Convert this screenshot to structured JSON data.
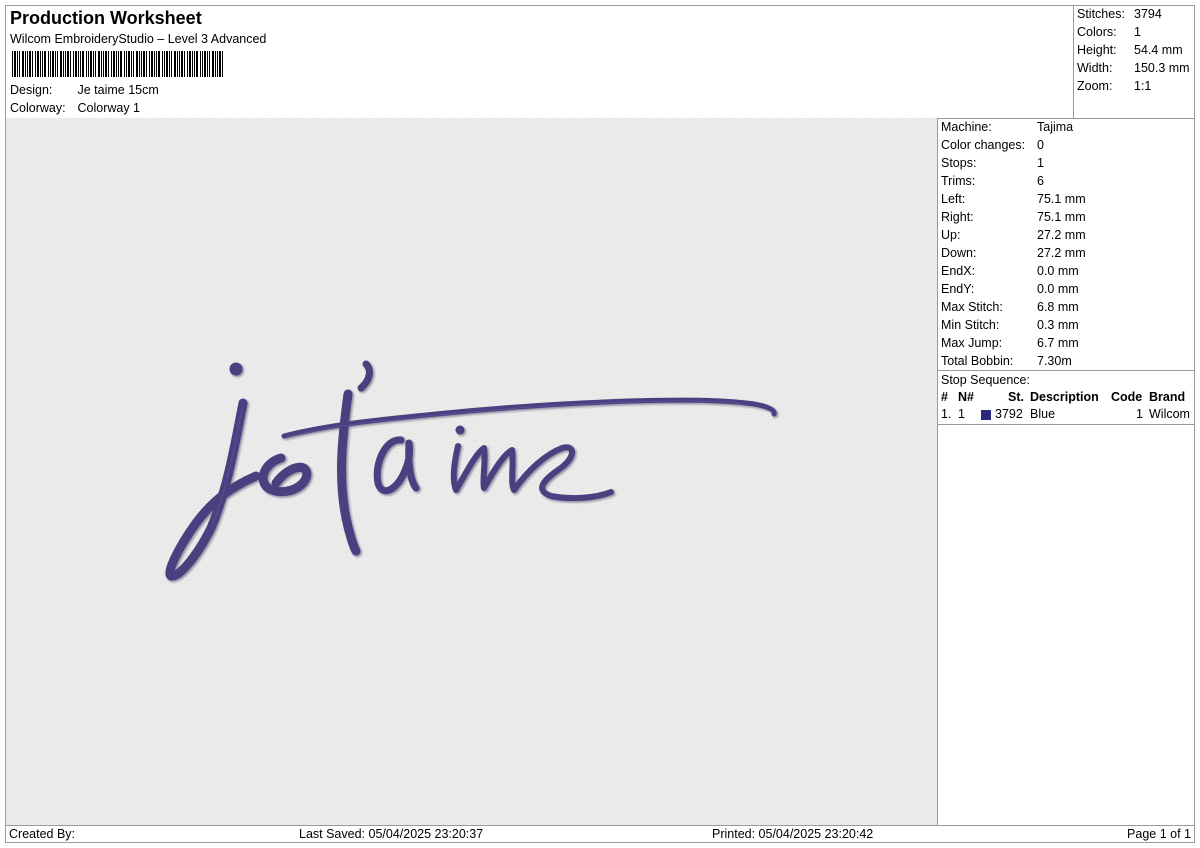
{
  "header": {
    "title": "Production Worksheet",
    "subtitle": "Wilcom EmbroideryStudio – Level 3 Advanced",
    "design_label": "Design:",
    "design_value": "Je taime 15cm",
    "colorway_label": "Colorway:",
    "colorway_value": "Colorway 1"
  },
  "summary": [
    {
      "label": "Stitches:",
      "value": "3794"
    },
    {
      "label": "Colors:",
      "value": "1"
    },
    {
      "label": "Height:",
      "value": "54.4 mm"
    },
    {
      "label": "Width:",
      "value": "150.3 mm"
    },
    {
      "label": "Zoom:",
      "value": "1:1"
    }
  ],
  "machine_info": [
    {
      "label": "Machine:",
      "value": "Tajima"
    },
    {
      "label": "Color changes:",
      "value": "0"
    },
    {
      "label": "Stops:",
      "value": "1"
    },
    {
      "label": "Trims:",
      "value": "6"
    },
    {
      "label": "Left:",
      "value": "75.1 mm"
    },
    {
      "label": "Right:",
      "value": "75.1 mm"
    },
    {
      "label": "Up:",
      "value": "27.2 mm"
    },
    {
      "label": "Down:",
      "value": "27.2 mm"
    },
    {
      "label": "EndX:",
      "value": "0.0 mm"
    },
    {
      "label": "EndY:",
      "value": "0.0 mm"
    },
    {
      "label": "Max Stitch:",
      "value": "6.8 mm"
    },
    {
      "label": "Min Stitch:",
      "value": "0.3 mm"
    },
    {
      "label": "Max Jump:",
      "value": "6.7 mm"
    },
    {
      "label": "Total Bobbin:",
      "value": "7.30m"
    }
  ],
  "stop_sequence": {
    "title": "Stop Sequence:",
    "columns": [
      "#",
      "N#",
      "St.",
      "Description",
      "Code",
      "Brand"
    ],
    "rows": [
      {
        "index": "1.",
        "n": "1",
        "st": "3792",
        "description": "Blue",
        "code": "1",
        "brand": "Wilcom",
        "color": "#2b2a7a"
      }
    ]
  },
  "design_colors": {
    "thread": "#4a4080",
    "thread_shadow": "#2e2660",
    "background": "#e9e9e9"
  },
  "footer": {
    "created_by": "Created By:",
    "last_saved": "Last Saved: 05/04/2025 23:20:37",
    "printed": "Printed: 05/04/2025 23:20:42",
    "page": "Page 1 of 1"
  }
}
